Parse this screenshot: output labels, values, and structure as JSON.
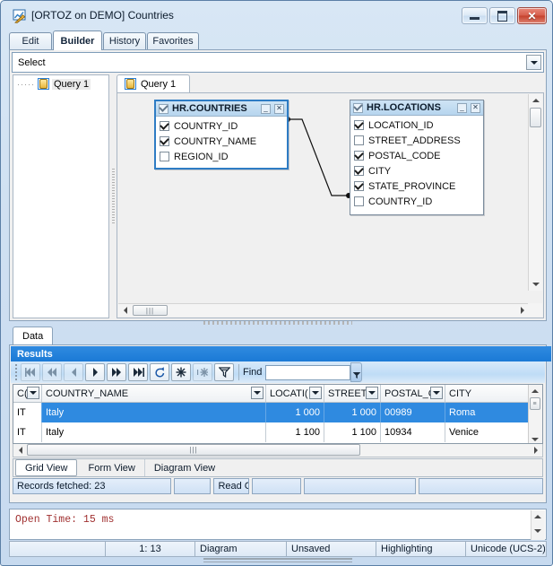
{
  "window": {
    "title": "[ORTOZ on DEMO] Countries",
    "icon": "query-builder-icon",
    "buttons": {
      "minimize": "minimize-icon",
      "maximize": "maximize-icon",
      "close": "close-icon"
    }
  },
  "main_tabs": [
    {
      "label": "Edit",
      "active": false
    },
    {
      "label": "Builder",
      "active": true
    },
    {
      "label": "History",
      "active": false
    },
    {
      "label": "Favorites",
      "active": false
    }
  ],
  "builder": {
    "statement_combo": {
      "value": "Select",
      "caret": "chevron-down-icon"
    },
    "tree": {
      "items": [
        {
          "label": "Query 1",
          "icon": "query-node-icon"
        }
      ]
    },
    "query_tabs": [
      {
        "label": "Query 1",
        "icon": "query-node-icon",
        "active": true
      }
    ],
    "diagram": {
      "tables": [
        {
          "name": "HR.COUNTRIES",
          "selected": true,
          "header_checked": true,
          "fields": [
            {
              "name": "COUNTRY_ID",
              "checked": true
            },
            {
              "name": "COUNTRY_NAME",
              "checked": true
            },
            {
              "name": "REGION_ID",
              "checked": false
            }
          ],
          "buttons": {
            "minimize": "minimize-icon",
            "close": "close-icon"
          }
        },
        {
          "name": "HR.LOCATIONS",
          "selected": false,
          "header_checked": true,
          "fields": [
            {
              "name": "LOCATION_ID",
              "checked": true
            },
            {
              "name": "STREET_ADDRESS",
              "checked": false
            },
            {
              "name": "POSTAL_CODE",
              "checked": true
            },
            {
              "name": "CITY",
              "checked": true
            },
            {
              "name": "STATE_PROVINCE",
              "checked": true
            },
            {
              "name": "COUNTRY_ID",
              "checked": false
            }
          ],
          "buttons": {
            "minimize": "minimize-icon",
            "close": "close-icon"
          }
        }
      ],
      "join": {
        "from": "HR.COUNTRIES.COUNTRY_ID",
        "to": "HR.LOCATIONS.COUNTRY_ID"
      }
    }
  },
  "data_panel": {
    "tab": "Data",
    "results_title": "Results",
    "nav_buttons": [
      {
        "name": "first-record-button",
        "icon": "first-icon",
        "enabled": false
      },
      {
        "name": "prior-page-button",
        "icon": "prev-page-icon",
        "enabled": false
      },
      {
        "name": "prior-record-button",
        "icon": "prev-icon",
        "enabled": false
      },
      {
        "name": "next-record-button",
        "icon": "next-icon",
        "enabled": true
      },
      {
        "name": "next-page-button",
        "icon": "next-page-icon",
        "enabled": true
      },
      {
        "name": "last-record-button",
        "icon": "last-icon",
        "enabled": true
      },
      {
        "name": "refresh-button",
        "icon": "refresh-icon",
        "enabled": true
      },
      {
        "name": "fetch-all-button",
        "icon": "asterisk-icon",
        "enabled": true
      },
      {
        "name": "stop-fetch-button",
        "icon": "asterisk-stop-icon",
        "enabled": false
      },
      {
        "name": "filter-button",
        "icon": "funnel-icon",
        "enabled": true
      }
    ],
    "find": {
      "label": "Find",
      "value": "",
      "placeholder": "",
      "dropdown_icon": "funnel-small-icon"
    },
    "grid": {
      "columns": [
        "C(",
        "COUNTRY_NAME",
        "LOCATI(",
        "STREET",
        "POSTAL_C",
        "CITY"
      ],
      "rows": [
        {
          "selected": true,
          "cells": [
            "IT",
            "Italy",
            "1 000",
            "1 000",
            "00989",
            "Roma"
          ]
        },
        {
          "selected": false,
          "cells": [
            "IT",
            "Italy",
            "1 100",
            "1 100",
            "10934",
            "Venice"
          ]
        }
      ]
    },
    "view_tabs": [
      {
        "label": "Grid View",
        "active": true
      },
      {
        "label": "Form View",
        "active": false
      },
      {
        "label": "Diagram View",
        "active": false
      }
    ],
    "status_cells": [
      "Records fetched: 23",
      "",
      "Read C",
      "",
      "",
      ""
    ]
  },
  "log": {
    "text": "Open Time: 15 ms",
    "color": "#a03030"
  },
  "status_bar": [
    "",
    "1: 13",
    "Diagram",
    "Unsaved",
    "Highlighting",
    "Unicode (UCS-2)"
  ]
}
